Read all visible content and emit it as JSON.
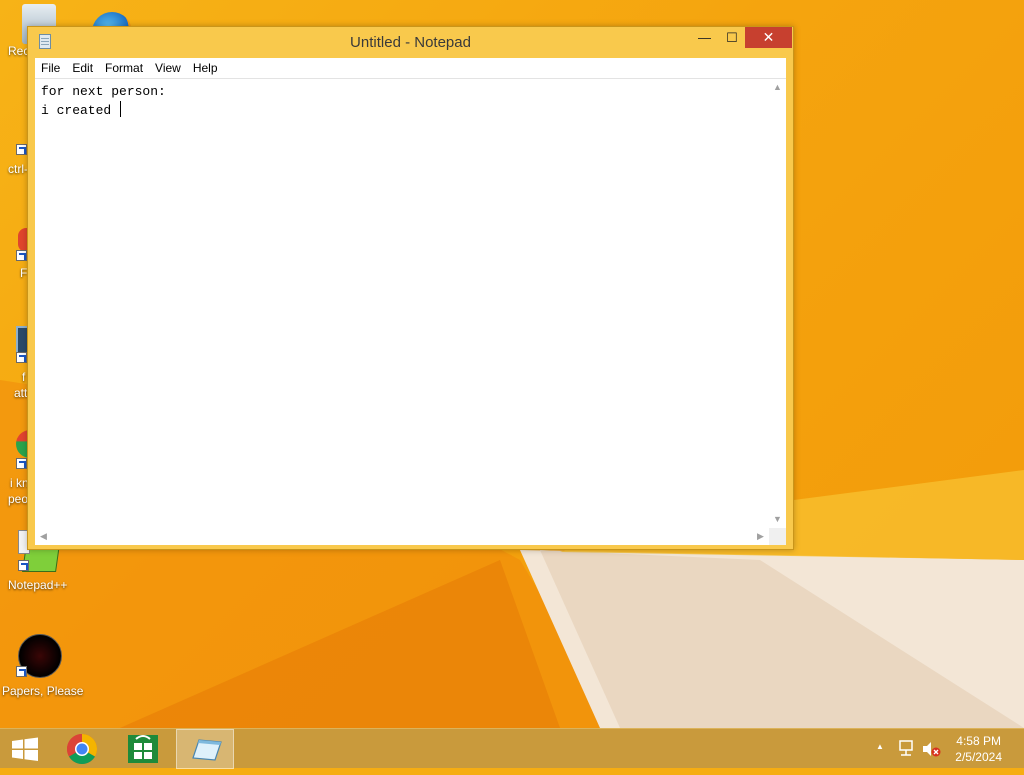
{
  "window": {
    "title": "Untitled - Notepad",
    "controls": {
      "minimize": "—",
      "maximize": "☐",
      "close": "✕"
    }
  },
  "menu": [
    "File",
    "Edit",
    "Format",
    "View",
    "Help"
  ],
  "editor": {
    "line1": "for next person:",
    "line2": "i created "
  },
  "desktop_icons": {
    "recycle": "Rec",
    "ctrl": "ctrl-",
    "f_item": "F",
    "file_att_1": "f",
    "file_att_2": "att",
    "ikn_1": "i kn",
    "ikn_2": "peo",
    "notepadpp": "Notepad++",
    "papers": "Papers, Please"
  },
  "taskbar": {
    "time": "4:58 PM",
    "date": "2/5/2024",
    "tray_chevron": "▲"
  },
  "colors": {
    "desktop_accent": "#f6ad12",
    "window_frame": "#f9c94c",
    "close_button": "#c7402f",
    "taskbar": "#c99a3c"
  }
}
